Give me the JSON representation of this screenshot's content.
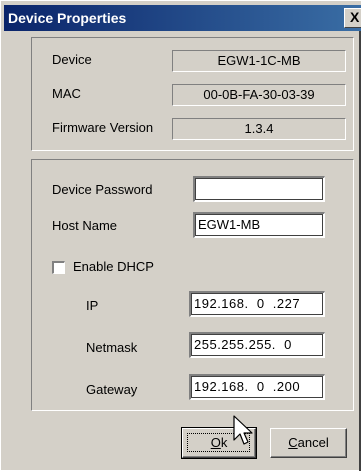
{
  "window": {
    "title": "Device Properties",
    "close_glyph": "X"
  },
  "info": {
    "device_label": "Device",
    "device_value": "EGW1-1C-MB",
    "mac_label": "MAC",
    "mac_value": "00-0B-FA-30-03-39",
    "firmware_label": "Firmware Version",
    "firmware_value": "1.3.4"
  },
  "settings": {
    "password_label": "Device Password",
    "password_value": "",
    "hostname_label": "Host Name",
    "hostname_value": "EGW1-MB",
    "dhcp_label": "Enable DHCP",
    "dhcp_checked": false,
    "ip_label": "IP",
    "ip_value": "192.168.  0  .227",
    "netmask_label": "Netmask",
    "netmask_value": "255.255.255.  0",
    "gateway_label": "Gateway",
    "gateway_value": "192.168.  0  .200"
  },
  "buttons": {
    "ok_mnemonic": "O",
    "ok_rest": "k",
    "cancel_mnemonic": "C",
    "cancel_rest": "ancel"
  },
  "icons": {
    "cursor": "mouse-pointer-icon",
    "close": "close-icon"
  }
}
